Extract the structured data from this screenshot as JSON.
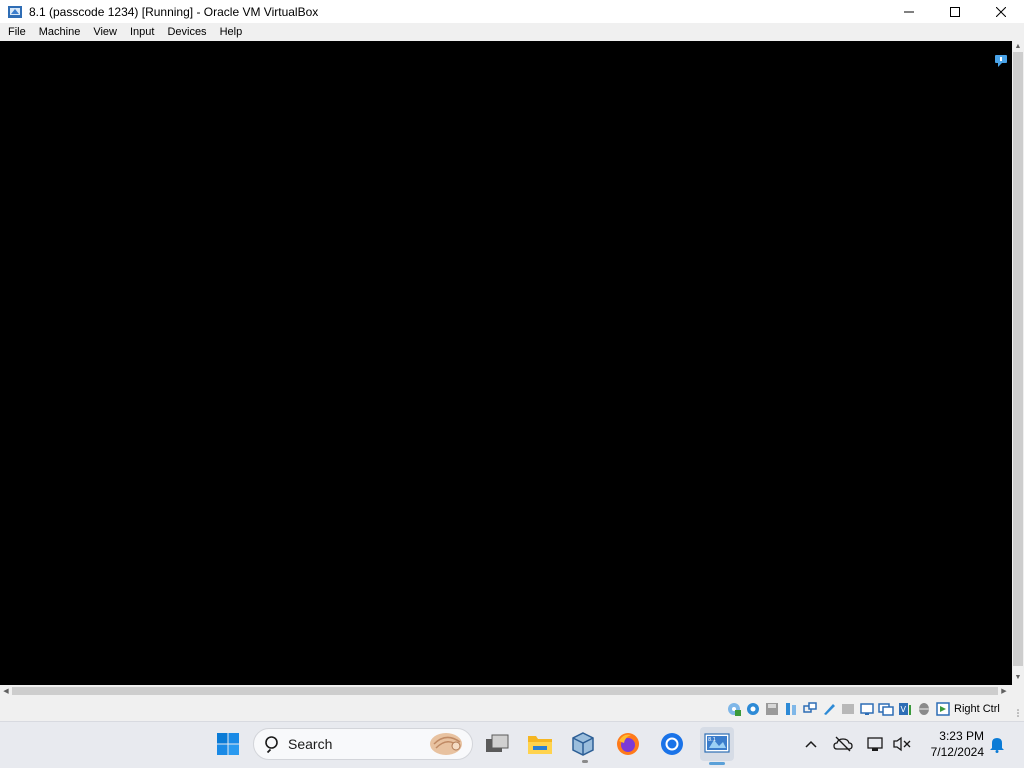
{
  "window": {
    "title": "8.1 (passcode 1234) [Running] - Oracle VM VirtualBox",
    "controls": {
      "minimize": "minimize-icon",
      "maximize": "maximize-icon",
      "close": "close-icon"
    }
  },
  "menubar": {
    "items": [
      {
        "label": "File"
      },
      {
        "label": "Machine"
      },
      {
        "label": "View"
      },
      {
        "label": "Input"
      },
      {
        "label": "Devices"
      },
      {
        "label": "Help"
      }
    ]
  },
  "statusbar": {
    "icons": [
      "optical-drive-icon",
      "audio-icon",
      "floppy-icon",
      "usb-icon",
      "network-icon",
      "shared-folder-icon",
      "display-icon",
      "hard-disk-icon",
      "recording-icon",
      "vt-x-icon",
      "mouse-integration-icon",
      "keyboard-capture-icon"
    ],
    "host_key": "Right Ctrl"
  },
  "taskbar": {
    "search_placeholder": "Search",
    "apps": [
      "start-icon",
      "task-view-icon",
      "file-explorer-icon",
      "virtualbox-icon",
      "firefox-icon",
      "chrome-icon",
      "virtualbox-vm-icon"
    ]
  },
  "tray": {
    "time": "3:23 PM",
    "date": "7/12/2024"
  },
  "colors": {
    "vm_background": "#000000",
    "accent": "#0067c0"
  }
}
